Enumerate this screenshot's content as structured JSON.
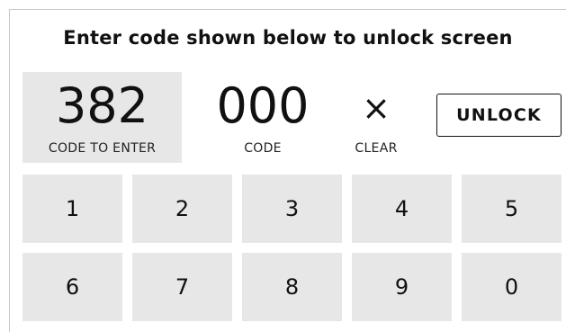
{
  "title": "Enter code shown below to unlock screen",
  "code_to_enter": {
    "value": "382",
    "label": "CODE TO ENTER"
  },
  "code": {
    "value": "000",
    "label": "CODE"
  },
  "clear": {
    "symbol": "×",
    "label": "CLEAR"
  },
  "unlock": {
    "label": "UNLOCK"
  },
  "keypad": {
    "keys": [
      "1",
      "2",
      "3",
      "4",
      "5",
      "6",
      "7",
      "8",
      "9",
      "0"
    ]
  },
  "colors": {
    "key_background": "#e6e7e6",
    "text": "#111111",
    "background": "#ffffff"
  }
}
